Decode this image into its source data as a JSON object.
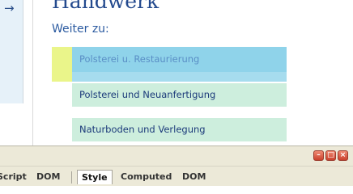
{
  "page": {
    "nav_arrow": "→",
    "heading": "Handwerk",
    "subheading": "Weiter zu:",
    "items": [
      {
        "label": "Polsterei u. Restaurierung"
      },
      {
        "label": "Polsterei und Neuanfertigung"
      },
      {
        "label": "Naturboden und Verlegung"
      }
    ]
  },
  "devtools": {
    "window_buttons": {
      "minimize": "–",
      "restore": "□",
      "close": "×"
    },
    "left_tabs": [
      "Script",
      "DOM"
    ],
    "right_tabs": [
      "Style",
      "Computed",
      "DOM"
    ],
    "active_tab": "Style"
  },
  "colors": {
    "heading": "#244a8e",
    "item_bg": "#cdeedd",
    "highlight_content": "#8fd3ea",
    "highlight_margin": "#eaf58a"
  }
}
